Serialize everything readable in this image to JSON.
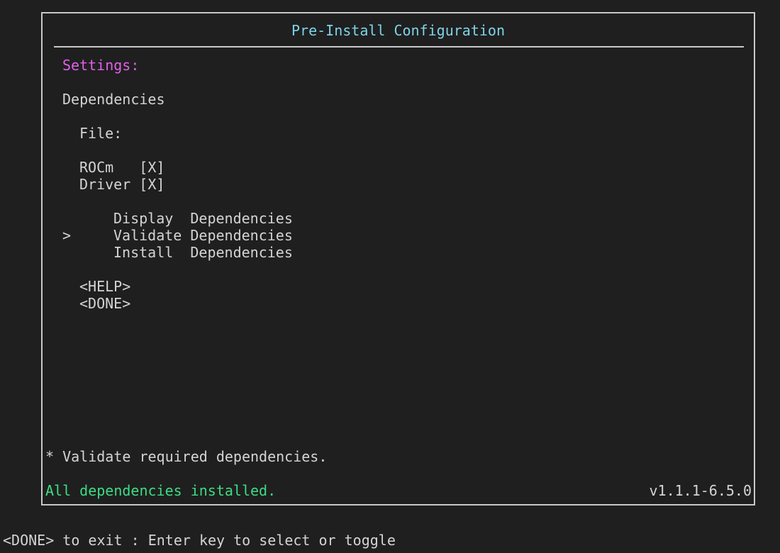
{
  "window": {
    "title": "Pre-Install Configuration",
    "title_color": "#7fd3e8"
  },
  "settings": {
    "heading": "Settings:",
    "heading_color": "#e060e8"
  },
  "dependencies": {
    "section_label": "Dependencies",
    "file_label": "File:",
    "options": [
      {
        "label": "ROCm   [X]",
        "checked": true
      },
      {
        "label": "Driver [X]",
        "checked": true
      }
    ]
  },
  "menu": {
    "cursor": ">",
    "selected_index": 1,
    "items": [
      {
        "label": "Display  Dependencies"
      },
      {
        "label": "Validate Dependencies"
      },
      {
        "label": "Install  Dependencies"
      }
    ]
  },
  "buttons": {
    "help": "<HELP>",
    "done": "<DONE>"
  },
  "footer": {
    "description": "* Validate required dependencies.",
    "status": "All dependencies installed.",
    "status_color": "#3ddc84",
    "version": "v1.1.1-6.5.0"
  },
  "hint": "<DONE> to exit : Enter key to select or toggle"
}
